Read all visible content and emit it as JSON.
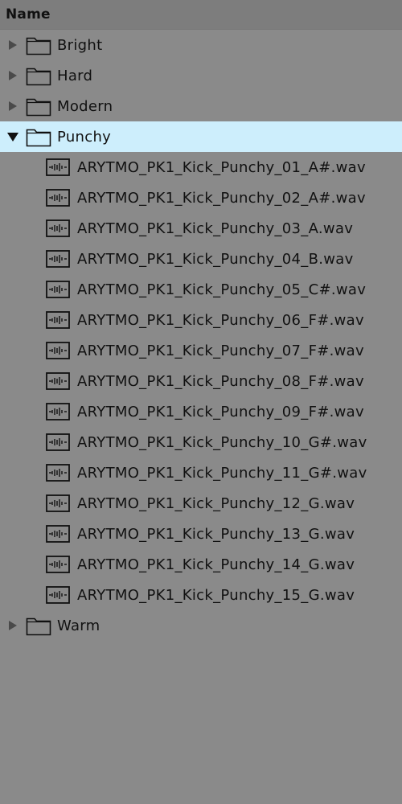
{
  "header": {
    "title": "Name"
  },
  "folders_before": [
    {
      "label": "Bright",
      "expanded": false
    },
    {
      "label": "Hard",
      "expanded": false
    },
    {
      "label": "Modern",
      "expanded": false
    }
  ],
  "open_folder": {
    "label": "Punchy",
    "expanded": true,
    "selected": true
  },
  "files": [
    {
      "label": "ARYTMO_PK1_Kick_Punchy_01_A#.wav",
      "icon": "audio-file-icon"
    },
    {
      "label": "ARYTMO_PK1_Kick_Punchy_02_A#.wav",
      "icon": "audio-file-icon"
    },
    {
      "label": "ARYTMO_PK1_Kick_Punchy_03_A.wav",
      "icon": "audio-file-icon"
    },
    {
      "label": "ARYTMO_PK1_Kick_Punchy_04_B.wav",
      "icon": "audio-file-icon"
    },
    {
      "label": "ARYTMO_PK1_Kick_Punchy_05_C#.wav",
      "icon": "audio-file-icon"
    },
    {
      "label": "ARYTMO_PK1_Kick_Punchy_06_F#.wav",
      "icon": "audio-file-icon"
    },
    {
      "label": "ARYTMO_PK1_Kick_Punchy_07_F#.wav",
      "icon": "audio-file-icon"
    },
    {
      "label": "ARYTMO_PK1_Kick_Punchy_08_F#.wav",
      "icon": "audio-file-icon"
    },
    {
      "label": "ARYTMO_PK1_Kick_Punchy_09_F#.wav",
      "icon": "audio-file-icon"
    },
    {
      "label": "ARYTMO_PK1_Kick_Punchy_10_G#.wav",
      "icon": "audio-file-icon"
    },
    {
      "label": "ARYTMO_PK1_Kick_Punchy_11_G#.wav",
      "icon": "audio-file-icon"
    },
    {
      "label": "ARYTMO_PK1_Kick_Punchy_12_G.wav",
      "icon": "audio-file-icon"
    },
    {
      "label": "ARYTMO_PK1_Kick_Punchy_13_G.wav",
      "icon": "audio-file-icon"
    },
    {
      "label": "ARYTMO_PK1_Kick_Punchy_14_G.wav",
      "icon": "audio-file-icon"
    },
    {
      "label": "ARYTMO_PK1_Kick_Punchy_15_G.wav",
      "icon": "audio-file-icon"
    }
  ],
  "folders_after": [
    {
      "label": "Warm",
      "expanded": false
    }
  ],
  "colors": {
    "background": "#8a8a8a",
    "header": "#7d7d7d",
    "selection": "#cdeefc",
    "text": "#111111"
  }
}
